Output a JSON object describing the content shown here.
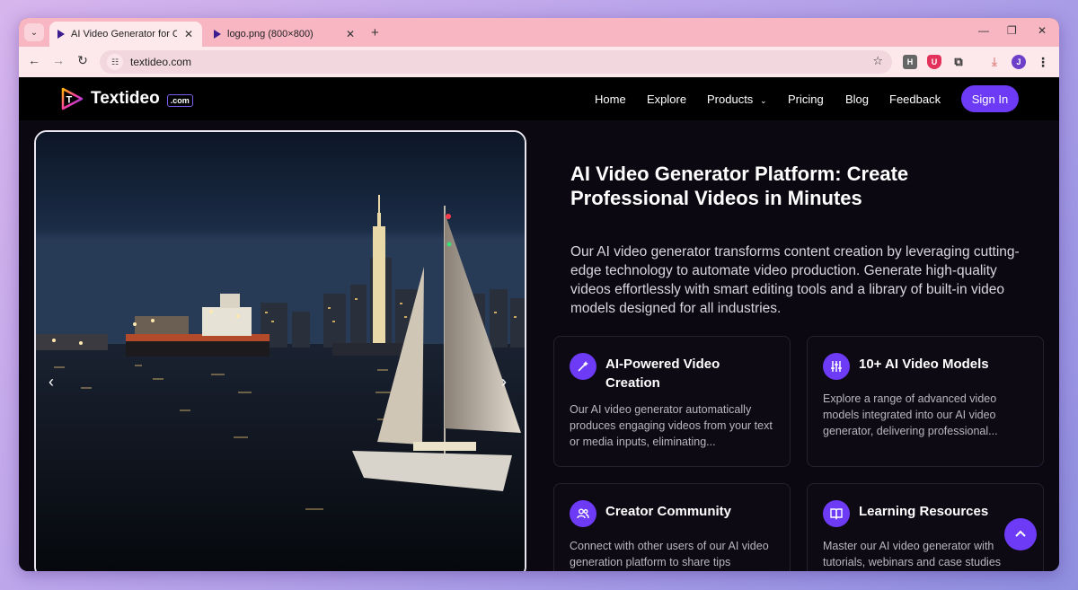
{
  "browser": {
    "tabs": [
      {
        "title": "AI Video Generator for Content",
        "active": true
      },
      {
        "title": "logo.png (800×800)",
        "active": false
      }
    ],
    "new_tab": "+",
    "window_controls": {
      "minimize": "—",
      "restore": "❐",
      "close": "✕"
    },
    "url": "textideo.com",
    "extensions": {
      "h_label": "H",
      "shield_label": "U",
      "avatar_label": "J"
    },
    "icons": [
      "tab-search-icon",
      "back-arrow-icon",
      "forward-arrow-icon",
      "reload-icon",
      "site-info-icon",
      "star-icon",
      "puzzle-icon",
      "download-icon",
      "kebab-menu-icon"
    ]
  },
  "site": {
    "logo_text": "Textideo",
    "logo_badge": ".com",
    "nav": {
      "home": "Home",
      "explore": "Explore",
      "products": "Products",
      "pricing": "Pricing",
      "blog": "Blog",
      "feedback": "Feedback",
      "sign_in": "Sign In"
    },
    "hero": {
      "title": "AI Video Generator Platform: Create Professional Videos in Minutes",
      "description": "Our AI video generator transforms content creation by leveraging cutting-edge technology to automate video production. Generate high-quality videos effortlessly with smart editing tools and a library of built-in video models designed for all industries."
    },
    "features": [
      {
        "title": "AI-Powered Video Creation",
        "text": "Our AI video generator automatically produces engaging videos from your text or media inputs, eliminating...",
        "icon": "magic-wand-icon"
      },
      {
        "title": "10+ AI Video Models",
        "text": "Explore a range of advanced video models integrated into our AI video generator, delivering professional...",
        "icon": "sliders-icon"
      },
      {
        "title": "Creator Community",
        "text": "Connect with other users of our AI video generation platform to share tips",
        "icon": "users-icon"
      },
      {
        "title": "Learning Resources",
        "text": "Master our AI video generator with tutorials, webinars and case studies",
        "icon": "book-icon"
      }
    ],
    "colors": {
      "accent": "#6d3af5",
      "background": "#0b0812",
      "nav_bg": "#000000"
    }
  }
}
